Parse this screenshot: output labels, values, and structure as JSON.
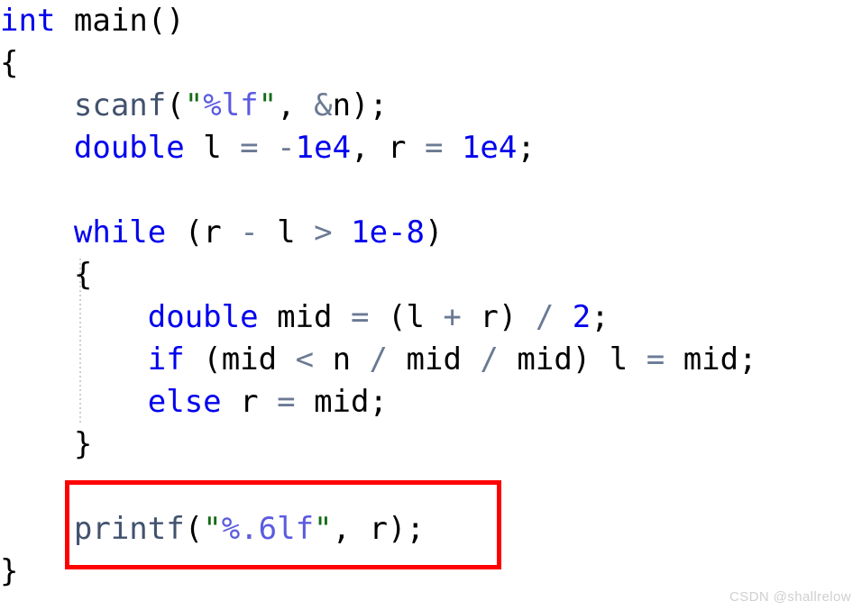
{
  "editor": {
    "language": "c",
    "background_color": "#ffffff",
    "colors": {
      "keyword": "#0000ee",
      "function": "#42526e",
      "number": "#0000ee",
      "operator": "#6b7a94",
      "identifier": "#000000",
      "string_quote": "#156b15",
      "format_specifier": "#5b5be0",
      "indent_guide": "#cfcfcf",
      "highlight_border": "#fe0000",
      "watermark": "#cfcfcf"
    },
    "lines": [
      {
        "number": 1,
        "indent": 0,
        "text": "int main()",
        "tokens": [
          {
            "t": "int",
            "c": "kw"
          },
          {
            "t": " ",
            "c": "id"
          },
          {
            "t": "main()",
            "c": "id"
          }
        ]
      },
      {
        "number": 2,
        "indent": 0,
        "text": "{",
        "tokens": [
          {
            "t": "{",
            "c": "brace"
          }
        ]
      },
      {
        "number": 3,
        "indent": 4,
        "text": "    scanf(\"%lf\", &n);",
        "tokens": [
          {
            "t": "    ",
            "c": "id"
          },
          {
            "t": "scanf",
            "c": "fn"
          },
          {
            "t": "(",
            "c": "punc"
          },
          {
            "t": "\"",
            "c": "quote"
          },
          {
            "t": "%lf",
            "c": "fmt"
          },
          {
            "t": "\"",
            "c": "quote"
          },
          {
            "t": ", ",
            "c": "punc"
          },
          {
            "t": "&",
            "c": "op"
          },
          {
            "t": "n",
            "c": "id"
          },
          {
            "t": ");",
            "c": "punc"
          }
        ]
      },
      {
        "number": 4,
        "indent": 4,
        "text": "    double l = -1e4, r = 1e4;",
        "tokens": [
          {
            "t": "    ",
            "c": "id"
          },
          {
            "t": "double",
            "c": "kw"
          },
          {
            "t": " ",
            "c": "id"
          },
          {
            "t": "l",
            "c": "id"
          },
          {
            "t": " ",
            "c": "id"
          },
          {
            "t": "=",
            "c": "op"
          },
          {
            "t": " ",
            "c": "id"
          },
          {
            "t": "-",
            "c": "op"
          },
          {
            "t": "1e4",
            "c": "num"
          },
          {
            "t": ", ",
            "c": "punc"
          },
          {
            "t": "r",
            "c": "id"
          },
          {
            "t": " ",
            "c": "id"
          },
          {
            "t": "=",
            "c": "op"
          },
          {
            "t": " ",
            "c": "id"
          },
          {
            "t": "1e4",
            "c": "num"
          },
          {
            "t": ";",
            "c": "punc"
          }
        ]
      },
      {
        "number": 5,
        "indent": 0,
        "text": "",
        "tokens": []
      },
      {
        "number": 6,
        "indent": 4,
        "text": "    while (r - l > 1e-8)",
        "tokens": [
          {
            "t": "    ",
            "c": "id"
          },
          {
            "t": "while",
            "c": "kw"
          },
          {
            "t": " ",
            "c": "id"
          },
          {
            "t": "(",
            "c": "punc"
          },
          {
            "t": "r",
            "c": "id"
          },
          {
            "t": " ",
            "c": "id"
          },
          {
            "t": "-",
            "c": "op"
          },
          {
            "t": " ",
            "c": "id"
          },
          {
            "t": "l",
            "c": "id"
          },
          {
            "t": " ",
            "c": "id"
          },
          {
            "t": ">",
            "c": "op"
          },
          {
            "t": " ",
            "c": "id"
          },
          {
            "t": "1e-8",
            "c": "num"
          },
          {
            "t": ")",
            "c": "punc"
          }
        ]
      },
      {
        "number": 7,
        "indent": 4,
        "text": "    {",
        "tokens": [
          {
            "t": "    ",
            "c": "id"
          },
          {
            "t": "{",
            "c": "brace"
          }
        ]
      },
      {
        "number": 8,
        "indent": 8,
        "text": "        double mid = (l + r) / 2;",
        "tokens": [
          {
            "t": "        ",
            "c": "id"
          },
          {
            "t": "double",
            "c": "kw"
          },
          {
            "t": " ",
            "c": "id"
          },
          {
            "t": "mid",
            "c": "id"
          },
          {
            "t": " ",
            "c": "id"
          },
          {
            "t": "=",
            "c": "op"
          },
          {
            "t": " ",
            "c": "id"
          },
          {
            "t": "(",
            "c": "punc"
          },
          {
            "t": "l",
            "c": "id"
          },
          {
            "t": " ",
            "c": "id"
          },
          {
            "t": "+",
            "c": "op"
          },
          {
            "t": " ",
            "c": "id"
          },
          {
            "t": "r",
            "c": "id"
          },
          {
            "t": ")",
            "c": "punc"
          },
          {
            "t": " ",
            "c": "id"
          },
          {
            "t": "/",
            "c": "op"
          },
          {
            "t": " ",
            "c": "id"
          },
          {
            "t": "2",
            "c": "num"
          },
          {
            "t": ";",
            "c": "punc"
          }
        ]
      },
      {
        "number": 9,
        "indent": 8,
        "text": "        if (mid < n / mid / mid) l = mid;",
        "tokens": [
          {
            "t": "        ",
            "c": "id"
          },
          {
            "t": "if",
            "c": "kw"
          },
          {
            "t": " ",
            "c": "id"
          },
          {
            "t": "(",
            "c": "punc"
          },
          {
            "t": "mid",
            "c": "id"
          },
          {
            "t": " ",
            "c": "id"
          },
          {
            "t": "<",
            "c": "op"
          },
          {
            "t": " ",
            "c": "id"
          },
          {
            "t": "n",
            "c": "id"
          },
          {
            "t": " ",
            "c": "id"
          },
          {
            "t": "/",
            "c": "op"
          },
          {
            "t": " ",
            "c": "id"
          },
          {
            "t": "mid",
            "c": "id"
          },
          {
            "t": " ",
            "c": "id"
          },
          {
            "t": "/",
            "c": "op"
          },
          {
            "t": " ",
            "c": "id"
          },
          {
            "t": "mid",
            "c": "id"
          },
          {
            "t": ")",
            "c": "punc"
          },
          {
            "t": " ",
            "c": "id"
          },
          {
            "t": "l",
            "c": "id"
          },
          {
            "t": " ",
            "c": "id"
          },
          {
            "t": "=",
            "c": "op"
          },
          {
            "t": " ",
            "c": "id"
          },
          {
            "t": "mid",
            "c": "id"
          },
          {
            "t": ";",
            "c": "punc"
          }
        ]
      },
      {
        "number": 10,
        "indent": 8,
        "text": "        else r = mid;",
        "tokens": [
          {
            "t": "        ",
            "c": "id"
          },
          {
            "t": "else",
            "c": "kw"
          },
          {
            "t": " ",
            "c": "id"
          },
          {
            "t": "r",
            "c": "id"
          },
          {
            "t": " ",
            "c": "id"
          },
          {
            "t": "=",
            "c": "op"
          },
          {
            "t": " ",
            "c": "id"
          },
          {
            "t": "mid",
            "c": "id"
          },
          {
            "t": ";",
            "c": "punc"
          }
        ]
      },
      {
        "number": 11,
        "indent": 4,
        "text": "    }",
        "tokens": [
          {
            "t": "    ",
            "c": "id"
          },
          {
            "t": "}",
            "c": "brace"
          }
        ]
      },
      {
        "number": 12,
        "indent": 0,
        "text": "",
        "tokens": []
      },
      {
        "number": 13,
        "indent": 4,
        "text": "    printf(\"%.6lf\", r);",
        "tokens": [
          {
            "t": "    ",
            "c": "id"
          },
          {
            "t": "printf",
            "c": "fn"
          },
          {
            "t": "(",
            "c": "punc"
          },
          {
            "t": "\"",
            "c": "quote"
          },
          {
            "t": "%.6lf",
            "c": "fmt"
          },
          {
            "t": "\"",
            "c": "quote"
          },
          {
            "t": ", ",
            "c": "punc"
          },
          {
            "t": "r",
            "c": "id"
          },
          {
            "t": ");",
            "c": "punc"
          }
        ]
      },
      {
        "number": 14,
        "indent": 0,
        "text": "}",
        "tokens": [
          {
            "t": "}",
            "c": "brace"
          }
        ]
      }
    ]
  },
  "highlight": {
    "label": "printf-line-highlight",
    "target_line": 13,
    "color": "#fe0000"
  },
  "watermark": {
    "text": "CSDN @shallrelow"
  }
}
